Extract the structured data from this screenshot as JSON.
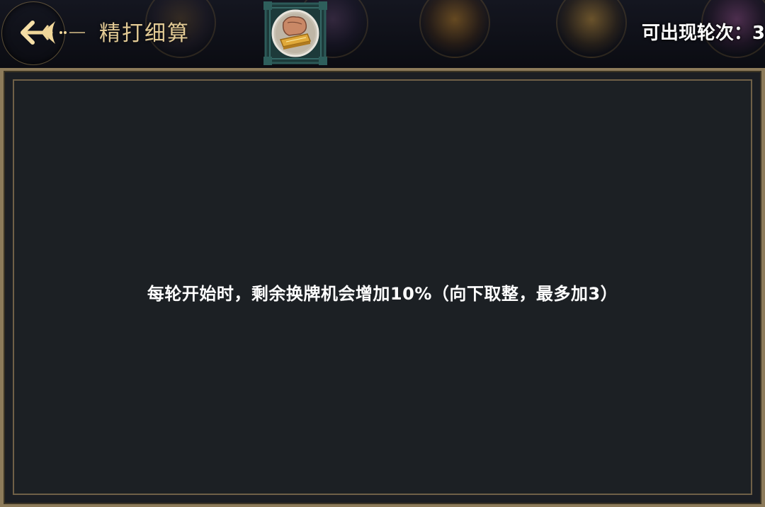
{
  "header": {
    "title": "精打细算",
    "round_label": "可出现轮次：3",
    "back_icon": "back-arrow-icon",
    "card_icon": "fist-gold-card-icon"
  },
  "panel": {
    "description": "每轮开始时，剩余换牌机会增加10%（向下取整，最多加3）"
  },
  "colors": {
    "title_gold": "#e2ca95",
    "panel_bg": "#1c2024",
    "frame_gold": "#8d7b5a",
    "text_white": "#ffffff"
  }
}
